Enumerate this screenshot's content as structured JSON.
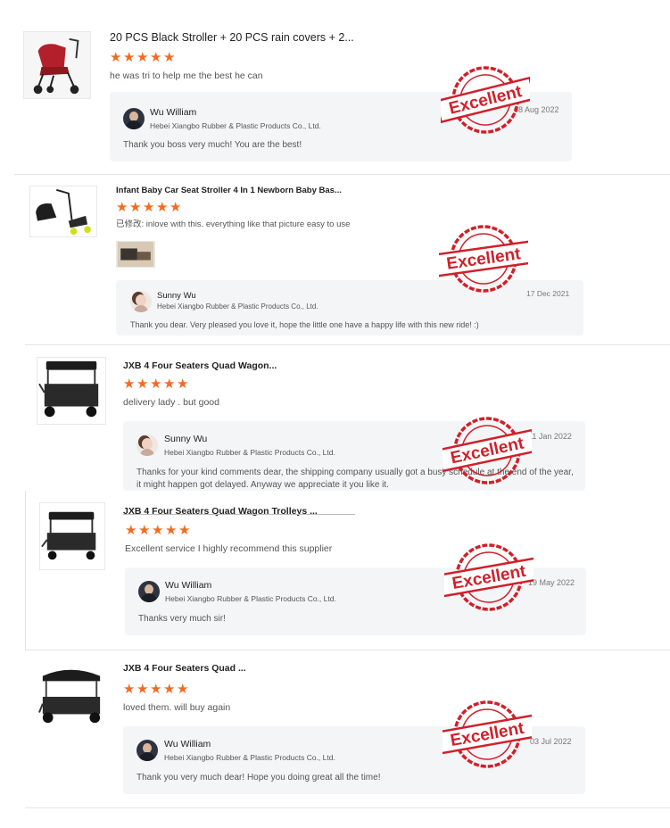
{
  "rating_icon": "star-icon",
  "colors": {
    "star": "#f36a20",
    "stamp": "#d0202a",
    "reply_bg": "#f4f5f7"
  },
  "stamp_label": "Excellent",
  "reviews": [
    {
      "product_title": "20 PCS Black Stroller + 20 PCS rain covers + 2...",
      "review_text": "he was tri to help me the best he can",
      "reply": {
        "name": "Wu William",
        "company": "Hebei Xiangbo Rubber & Plastic Products Co., Ltd.",
        "date": "08 Aug 2022",
        "message": "Thank you boss very much! You are the best!"
      }
    },
    {
      "product_title": "Infant Baby Car Seat Stroller 4 In 1 Newborn Baby Bas...",
      "review_text": "已修改: inlove with this. everything like that picture easy to use",
      "reply": {
        "name": "Sunny Wu",
        "company": "Hebei Xiangbo Rubber & Plastic Products Co., Ltd.",
        "date": "17 Dec 2021",
        "message": "Thank you dear. Very pleased you love it, hope the little one have a happy life with this new ride!   :)"
      }
    },
    {
      "product_title": "JXB 4 Four Seaters Quad Wagon...",
      "review_text": "delivery lady . but good",
      "reply": {
        "name": "Sunny Wu",
        "company": "Hebei Xiangbo Rubber & Plastic Products Co., Ltd.",
        "date": "11 Jan 2022",
        "message": "Thanks for your kind comments dear, the shipping company usually got a busy schedule at the end of the year, it might happen got delayed. Anyway we appreciate it you like it."
      }
    },
    {
      "product_title": "JXB 4 Four Seaters Quad Wagon Trolleys ...",
      "review_text": "Excellent service I highly recommend this supplier",
      "reply": {
        "name": "Wu William",
        "company": "Hebei Xiangbo Rubber & Plastic Products Co., Ltd.",
        "date": "19 May 2022",
        "message": "Thanks very much sir!"
      }
    },
    {
      "product_title": "JXB 4 Four Seaters Quad ...",
      "review_text": "loved them. will buy again",
      "reply": {
        "name": "Wu William",
        "company": "Hebei Xiangbo Rubber & Plastic Products Co., Ltd.",
        "date": "03 Jul 2022",
        "message": "Thank you very much dear! Hope you doing great all the time!"
      }
    }
  ]
}
